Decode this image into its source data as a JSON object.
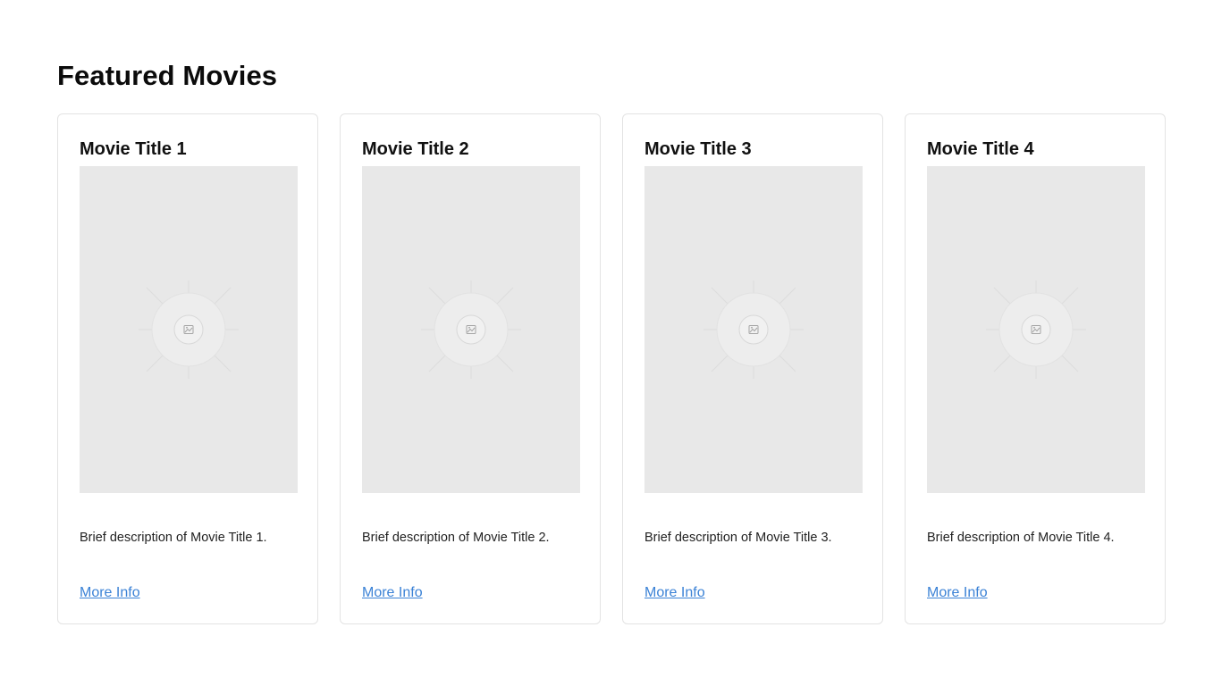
{
  "page": {
    "heading": "Featured Movies"
  },
  "movies": [
    {
      "title": "Movie Title 1",
      "description": "Brief description of Movie Title 1.",
      "link_label": "More Info",
      "poster_icon": "image-placeholder-icon"
    },
    {
      "title": "Movie Title 2",
      "description": "Brief description of Movie Title 2.",
      "link_label": "More Info",
      "poster_icon": "image-placeholder-icon"
    },
    {
      "title": "Movie Title 3",
      "description": "Brief description of Movie Title 3.",
      "link_label": "More Info",
      "poster_icon": "image-placeholder-icon"
    },
    {
      "title": "Movie Title 4",
      "description": "Brief description of Movie Title 4.",
      "link_label": "More Info",
      "poster_icon": "image-placeholder-icon"
    }
  ],
  "colors": {
    "link": "#3b82d6",
    "poster_bg": "#e8e8e8",
    "card_border": "#e3e3e3"
  }
}
